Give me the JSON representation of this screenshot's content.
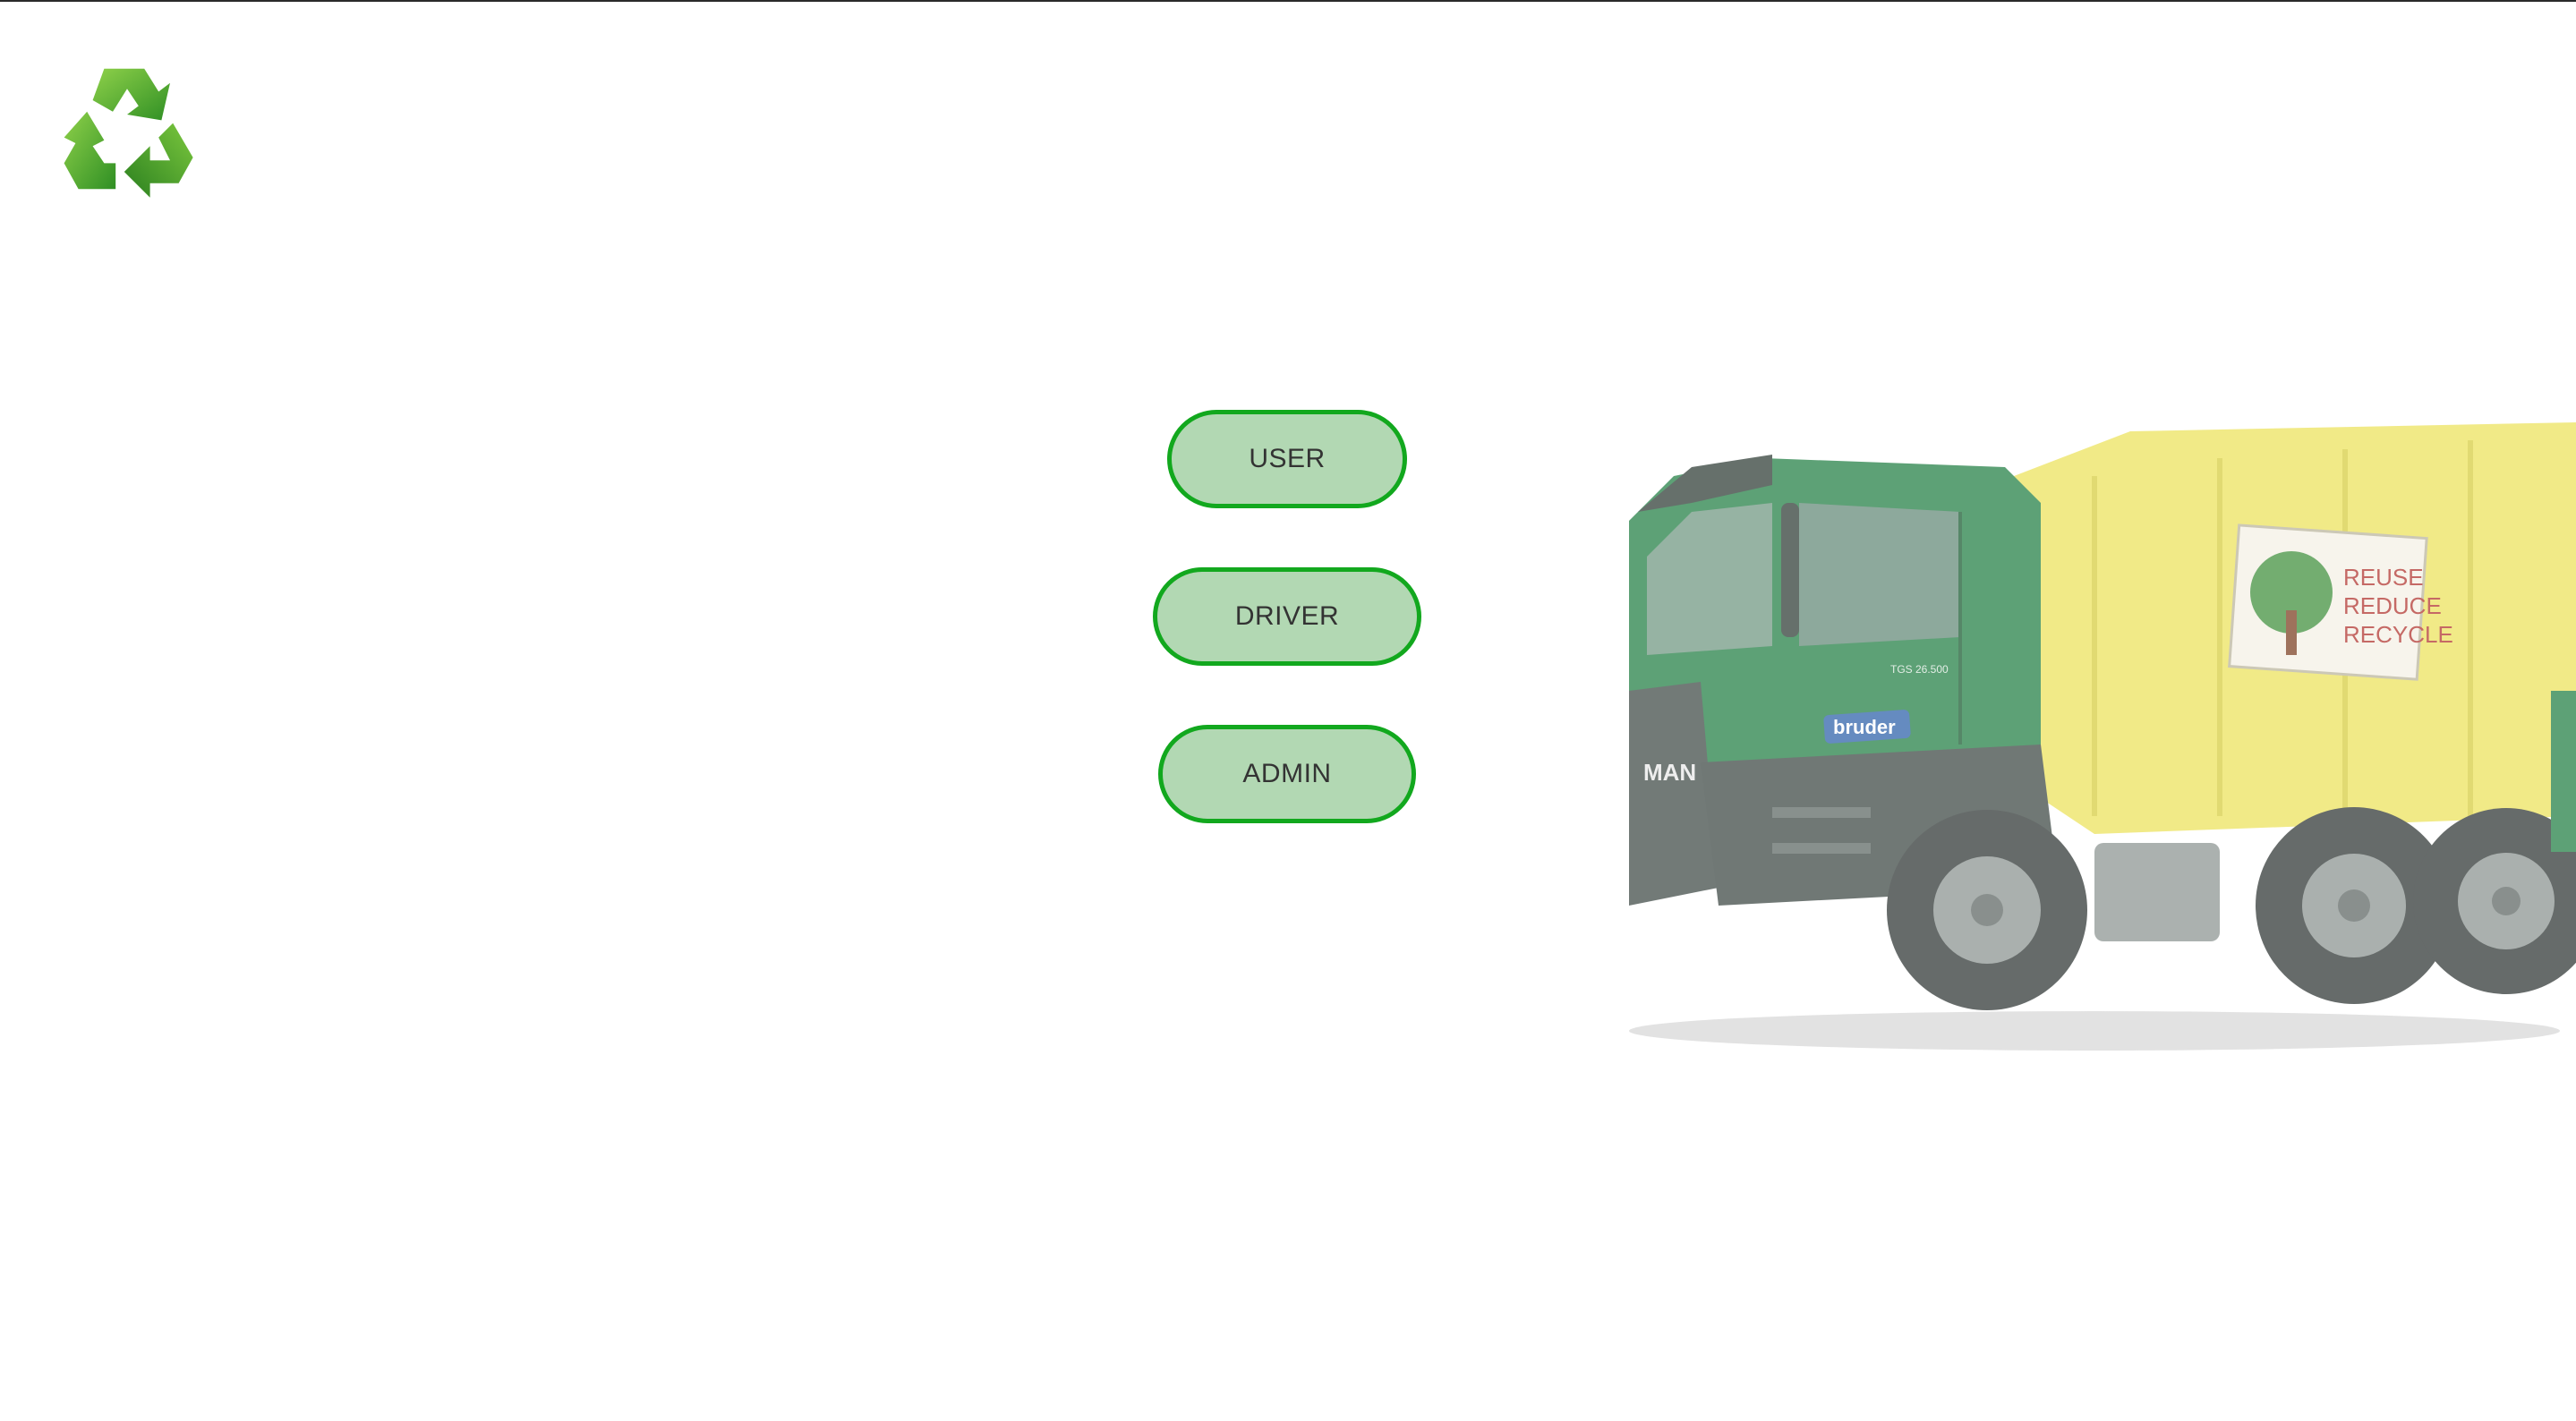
{
  "logo": {
    "icon": "recycle-icon",
    "color": "#4caf2a"
  },
  "buttons": {
    "user": "USER",
    "driver": "DRIVER",
    "admin": "ADMIN"
  },
  "truck": {
    "icon": "garbage-truck-illustration",
    "sign_lines": [
      "REUSE",
      "REDUCE",
      "RECYCLE"
    ],
    "brand_badge": "bruder",
    "grille_brand": "MAN",
    "model_badge": "TGS 26.500",
    "cab_color": "#1e7a3e",
    "body_color": "#e8e04a"
  },
  "colors": {
    "button_border": "#12a81e",
    "button_fill": "#b2d8b3",
    "button_text": "#333333"
  }
}
